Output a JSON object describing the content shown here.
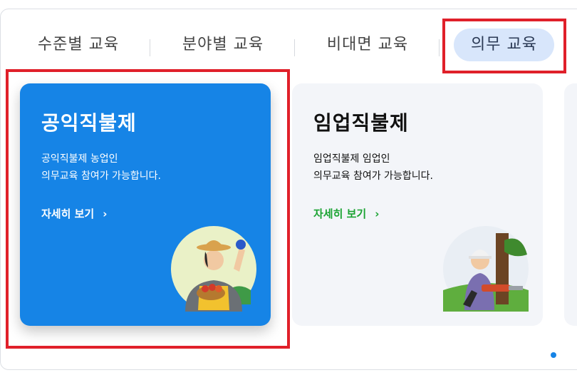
{
  "tabs": [
    {
      "label": "수준별 교육"
    },
    {
      "label": "분야별 교육"
    },
    {
      "label": "비대면 교육"
    },
    {
      "label": "의무 교육",
      "active": true
    }
  ],
  "cards": [
    {
      "title": "공익직불제",
      "desc_line1": "공익직불제 농업인",
      "desc_line2": "의무교육 참여가 가능합니다.",
      "link": "자세히 보기",
      "illustration_icon": "farmer-with-vegetable-basket-icon"
    },
    {
      "title": "임업직불제",
      "desc_line1": "임업직불제 임업인",
      "desc_line2": "의무교육 참여가 가능합니다.",
      "link": "자세히 보기",
      "illustration_icon": "forester-with-chainsaw-icon"
    }
  ],
  "colors": {
    "active_card": "#1684e6",
    "active_tab_bg": "#d8e6fb",
    "link_green": "#1aa332",
    "highlight_box": "#e0202a"
  }
}
